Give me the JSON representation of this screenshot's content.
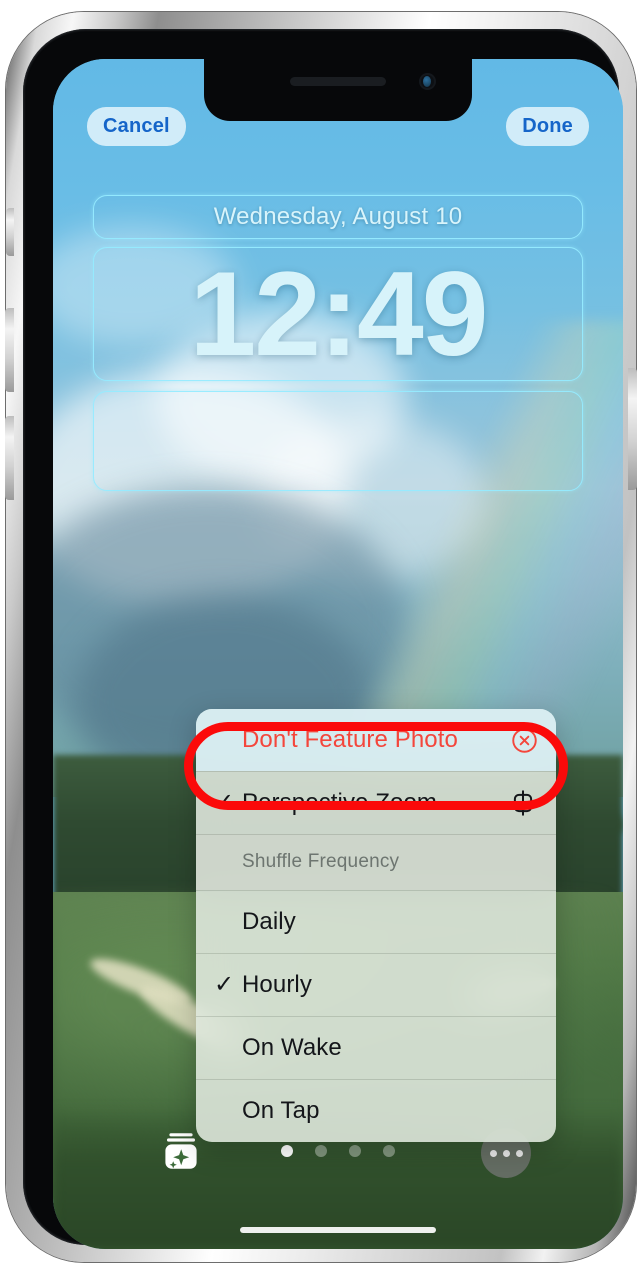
{
  "device": {
    "name": "iPhone"
  },
  "topbar": {
    "cancel_label": "Cancel",
    "done_label": "Done"
  },
  "lockscreen": {
    "date": "Wednesday, August 10",
    "time": "12:49",
    "widget_slot_empty": true
  },
  "context_menu": {
    "rows": [
      {
        "label": "Don't Feature Photo",
        "checked": false,
        "destructive": true,
        "icon": "close-circle-icon"
      },
      {
        "label": "Perspective Zoom",
        "checked": true,
        "destructive": false,
        "icon": "perspective-zoom-icon"
      }
    ],
    "section_header": "Shuffle Frequency",
    "frequency_options": [
      {
        "label": "Daily",
        "checked": false
      },
      {
        "label": "Hourly",
        "checked": true
      },
      {
        "label": "On Wake",
        "checked": false
      },
      {
        "label": "On Tap",
        "checked": false
      }
    ],
    "checkmark": "✓"
  },
  "bottombar": {
    "shuffle_icon": "photo-shuffle-icon",
    "more_icon": "ellipsis-icon",
    "page_dots": {
      "count": 4,
      "active_index": 0
    }
  },
  "colors": {
    "accent_blue": "#1565c9",
    "destructive_red": "#f4463c",
    "highlight_red": "#fb0a0a",
    "menu_background": "#e1e9df",
    "widget_outline": "#96ebff"
  }
}
